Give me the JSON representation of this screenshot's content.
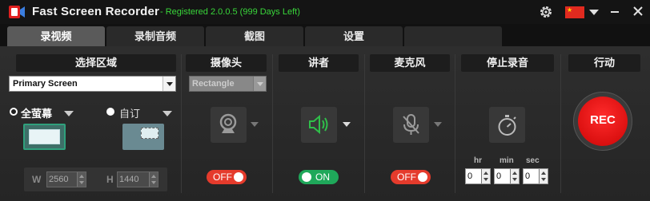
{
  "app": {
    "title": "Fast Screen Recorder",
    "registration": "- Registered 2.0.0.5 (999 Days Left)"
  },
  "tabs": [
    {
      "label": "录视频",
      "active": true
    },
    {
      "label": "录制音频",
      "active": false
    },
    {
      "label": "截图",
      "active": false
    },
    {
      "label": "设置",
      "active": false
    }
  ],
  "select_area": {
    "header": "选择区域",
    "dropdown_value": "Primary Screen",
    "fullscreen_label": "全萤幕",
    "custom_label": "自订",
    "width_label": "W",
    "width_value": "2560",
    "height_label": "H",
    "height_value": "1440"
  },
  "camera": {
    "header": "摄像头",
    "dropdown_value": "Rectangle",
    "toggle": "OFF"
  },
  "speaker": {
    "header": "讲者",
    "toggle": "ON"
  },
  "microphone": {
    "header": "麦克风",
    "toggle": "OFF"
  },
  "stop": {
    "header": "停止录音",
    "hr_label": "hr",
    "min_label": "min",
    "sec_label": "sec",
    "hr_value": "0",
    "min_value": "0",
    "sec_value": "0"
  },
  "action": {
    "header": "行动",
    "rec_label": "REC"
  },
  "colors": {
    "registered_text": "#39d63a",
    "toggle_off": "#e53b2c",
    "toggle_on": "#1fa85a",
    "rec_red": "#e00a0a",
    "speaker_green": "#2fbf4a"
  }
}
